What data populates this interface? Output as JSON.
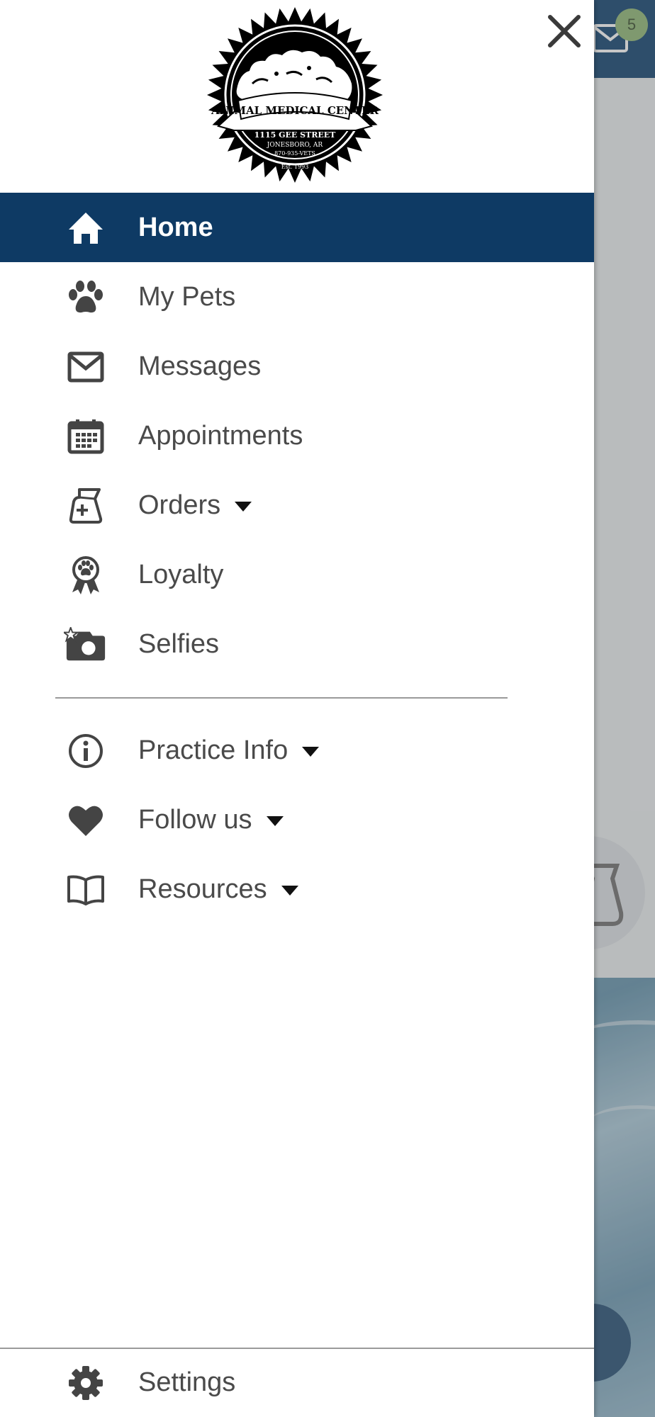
{
  "background": {
    "unread_badge": "5"
  },
  "drawer": {
    "logo": {
      "title": "ANIMAL MEDICAL CENTER",
      "address_line1": "1115 GEE STREET",
      "address_line2": "JONESBORO, AR",
      "phone": "870-935-VETS",
      "established": "Est. 1993"
    },
    "nav": {
      "home": {
        "label": "Home",
        "icon": "home-icon"
      },
      "my_pets": {
        "label": "My Pets",
        "icon": "paw-icon"
      },
      "messages": {
        "label": "Messages",
        "icon": "envelope-icon"
      },
      "appointments": {
        "label": "Appointments",
        "icon": "calendar-icon"
      },
      "orders": {
        "label": "Orders",
        "icon": "food-bag-icon"
      },
      "loyalty": {
        "label": "Loyalty",
        "icon": "award-ribbon-icon"
      },
      "selfies": {
        "label": "Selfies",
        "icon": "camera-icon"
      },
      "practice_info": {
        "label": "Practice Info",
        "icon": "info-icon"
      },
      "follow_us": {
        "label": "Follow us",
        "icon": "heart-icon"
      },
      "resources": {
        "label": "Resources",
        "icon": "book-icon"
      },
      "settings": {
        "label": "Settings",
        "icon": "gear-icon"
      }
    }
  },
  "colors": {
    "active_nav_bg": "#0e3a64",
    "text": "#4a4a4a",
    "icon": "#444444",
    "header_bg": "#3c6489",
    "badge_bg": "#a3c48f"
  }
}
